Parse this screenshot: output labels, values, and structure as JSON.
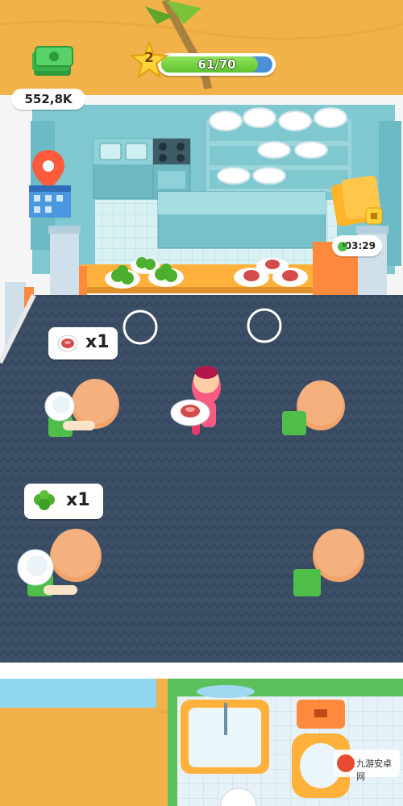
{
  "hud": {
    "money": "552,8K",
    "level": "2",
    "xp_text": "61/70",
    "xp_progress": 0.871,
    "timer": "03:29"
  },
  "orders": [
    {
      "item": "steak",
      "icon": "steak-icon",
      "count": "x1"
    },
    {
      "item": "broccoli",
      "icon": "broccoli-icon",
      "count": "x1"
    }
  ],
  "watermark": "九游安卓网",
  "colors": {
    "floor": "#3d4f66",
    "wall": "#f3f3f3",
    "kitchen": "#7fc8d0",
    "sand": "#f2b24a",
    "xp_fill": "#6ad13a"
  }
}
